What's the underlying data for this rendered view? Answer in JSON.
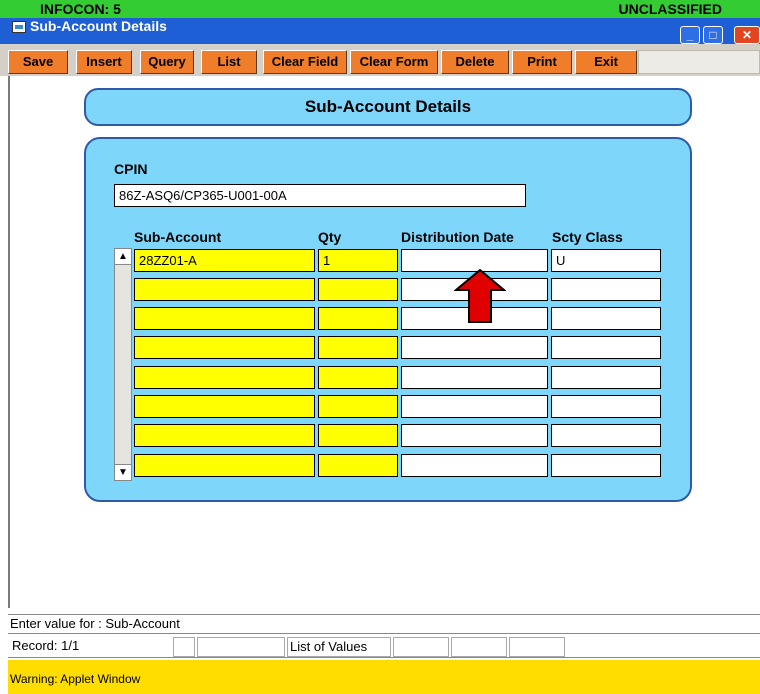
{
  "window": {
    "infocon": "INFOCON: 5",
    "classification": "UNCLASSIFIED",
    "title": "Sub-Account Details"
  },
  "toolbar": {
    "save": "Save",
    "insert": "Insert",
    "query": "Query",
    "list": "List",
    "clear_field": "Clear Field",
    "clear_form": "Clear Form",
    "delete": "Delete",
    "print": "Print",
    "exit": "Exit"
  },
  "form": {
    "header": "Sub-Account Details",
    "cpin_label": "CPIN",
    "cpin_value": "86Z-ASQ6/CP365-U001-00A",
    "columns": {
      "sub_account": "Sub-Account",
      "qty": "Qty",
      "distribution_date": "Distribution Date",
      "scty_class": "Scty Class"
    },
    "rows": [
      {
        "sub_account": "28ZZ01-A",
        "qty": "1",
        "distribution_date": "",
        "scty_class": "U"
      },
      {
        "sub_account": "",
        "qty": "",
        "distribution_date": "",
        "scty_class": ""
      },
      {
        "sub_account": "",
        "qty": "",
        "distribution_date": "",
        "scty_class": ""
      },
      {
        "sub_account": "",
        "qty": "",
        "distribution_date": "",
        "scty_class": ""
      },
      {
        "sub_account": "",
        "qty": "",
        "distribution_date": "",
        "scty_class": ""
      },
      {
        "sub_account": "",
        "qty": "",
        "distribution_date": "",
        "scty_class": ""
      },
      {
        "sub_account": "",
        "qty": "",
        "distribution_date": "",
        "scty_class": ""
      },
      {
        "sub_account": "",
        "qty": "",
        "distribution_date": "",
        "scty_class": ""
      }
    ]
  },
  "status": {
    "hint": "Enter value for : Sub-Account",
    "record": "Record: 1/1",
    "list_of_values": "List of Values",
    "warning": "Warning: Applet Window"
  },
  "colors": {
    "infocon_strip": "#33cc33",
    "title_bar": "#1f5fd6",
    "toolbar_button": "#f07d2a",
    "panel": "#7fd6fb",
    "required_field": "#ffff00",
    "warning_bar": "#ffdd00",
    "annotation_arrow": "#e00000"
  },
  "icons": {
    "app": "applet-window-icon",
    "minimize": "minimize-icon",
    "maximize": "maximize-icon",
    "close": "close-icon",
    "scroll_up": "scroll-up-arrow-icon",
    "scroll_down": "scroll-down-arrow-icon",
    "annotation": "red-up-arrow-icon"
  }
}
